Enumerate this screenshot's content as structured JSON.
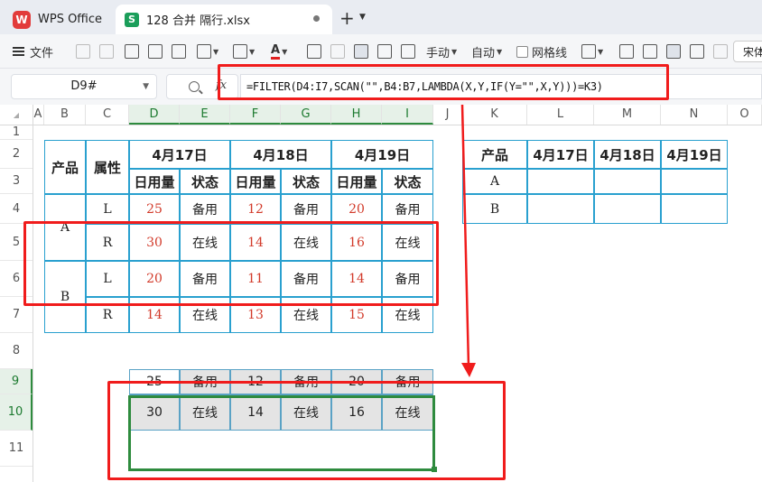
{
  "titlebar": {
    "app_tab": "WPS Office",
    "file_tab": "128 合并 隔行.xlsx",
    "new_tab": "+"
  },
  "toolbar": {
    "file_label": "文件",
    "wrap_mode_label": "手动",
    "auto_label": "自动",
    "gridlines_label": "网格线",
    "font_name": "宋体"
  },
  "formula_bar": {
    "name_box": "D9#",
    "fx": "fx",
    "formula": "=FILTER(D4:I7,SCAN(\"\",B4:B7,LAMBDA(X,Y,IF(Y=\"\",X,Y)))=K3)"
  },
  "columns": [
    "A",
    "B",
    "C",
    "D",
    "E",
    "F",
    "G",
    "H",
    "I",
    "J",
    "K",
    "L",
    "M",
    "N",
    "O"
  ],
  "rows": [
    "1",
    "2",
    "3",
    "4",
    "5",
    "6",
    "7",
    "8",
    "9",
    "10",
    "11"
  ],
  "source_table": {
    "header_product": "产品",
    "header_attr": "属性",
    "dates": [
      "4月17日",
      "4月18日",
      "4月19日"
    ],
    "sub_usage": "日用量",
    "sub_status": "状态",
    "groups": [
      {
        "product": "A",
        "rows": [
          {
            "attr": "L",
            "cells": [
              "25",
              "备用",
              "12",
              "备用",
              "20",
              "备用"
            ]
          },
          {
            "attr": "R",
            "cells": [
              "30",
              "在线",
              "14",
              "在线",
              "16",
              "在线"
            ]
          }
        ]
      },
      {
        "product": "B",
        "rows": [
          {
            "attr": "L",
            "cells": [
              "20",
              "备用",
              "11",
              "备用",
              "14",
              "备用"
            ]
          },
          {
            "attr": "R",
            "cells": [
              "14",
              "在线",
              "13",
              "在线",
              "15",
              "在线"
            ]
          }
        ]
      }
    ]
  },
  "lookup_table": {
    "header": "产品",
    "dates": [
      "4月17日",
      "4月18日",
      "4月19日"
    ],
    "products": [
      "A",
      "B"
    ]
  },
  "result": {
    "rows": [
      [
        "25",
        "备用",
        "12",
        "备用",
        "20",
        "备用"
      ],
      [
        "30",
        "在线",
        "14",
        "在线",
        "16",
        "在线"
      ]
    ]
  },
  "colors": {
    "accent_green": "#2e8b3e",
    "annotation_red": "#f01c1c",
    "table_border": "#29a0cf",
    "value_red": "#d23a2a"
  }
}
